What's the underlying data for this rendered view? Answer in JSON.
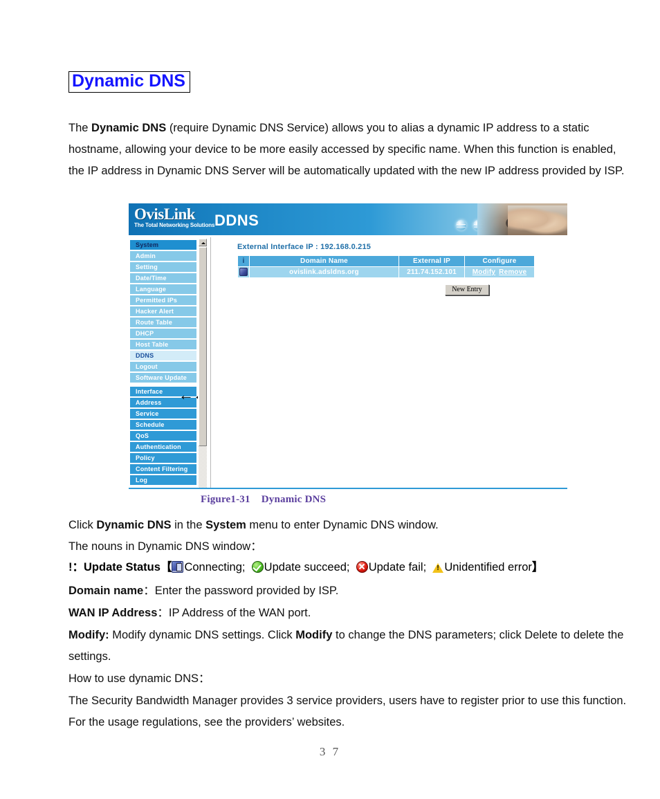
{
  "document": {
    "heading": "Dynamic DNS",
    "intro": {
      "part1": "The ",
      "bold1": "Dynamic DNS",
      "part2": " (require Dynamic DNS Service) allows you to alias a dynamic IP address to a static hostname, allowing your device to be more easily accessed by specific name. When this function is enabled, the IP address in Dynamic DNS Server will be automatically updated with the new IP address provided by ISP."
    },
    "figure_caption": {
      "label": "Figure1-31",
      "title": "Dynamic DNS"
    },
    "click_line": {
      "part1": "Click ",
      "bold1": "Dynamic DNS",
      "part2": " in the ",
      "bold2": "System",
      "part3": " menu to enter Dynamic DNS window."
    },
    "nouns_line": "The nouns in Dynamic DNS window：",
    "status_line": {
      "prefix": "!：",
      "label": "Update Status",
      "open_bracket": "【",
      "connecting": "Connecting;",
      "succeed": "Update succeed;",
      "fail": "Update fail;",
      "unidentified": "Unidentified error",
      "close_bracket": "】"
    },
    "domain_line": {
      "label": "Domain name",
      "text": "：Enter the password provided by ISP."
    },
    "wan_line": {
      "label": "WAN IP Address",
      "text": "：IP Address of the WAN port."
    },
    "modify_line": {
      "label": "Modify:",
      "part1": " Modify dynamic DNS settings. Click ",
      "bold1": "Modify",
      "part2": " to change the DNS parameters; click Delete to delete the settings."
    },
    "howto_line": "How to use dynamic DNS：",
    "providers_line": "The Security Bandwidth Manager provides 3 service providers, users have to register prior to use this function.　 For the usage regulations, see the providers’ websites.",
    "page_number": "3 7"
  },
  "screenshot": {
    "header": {
      "logo_main": "OvisLink",
      "logo_sub": "The Total Networking Solutions",
      "title": "DDNS"
    },
    "sidebar": {
      "group_system": {
        "header": "System",
        "items": [
          {
            "label": "Admin",
            "active": false
          },
          {
            "label": "Setting",
            "active": false
          },
          {
            "label": "Date/Time",
            "active": false
          },
          {
            "label": "Language",
            "active": false
          },
          {
            "label": "Permitted IPs",
            "active": false
          },
          {
            "label": "Hacker Alert",
            "active": false
          },
          {
            "label": "Route Table",
            "active": false
          },
          {
            "label": "DHCP",
            "active": false
          },
          {
            "label": "Host Table",
            "active": false
          },
          {
            "label": "DDNS",
            "active": true
          },
          {
            "label": "Logout",
            "active": false
          },
          {
            "label": "Software Update",
            "active": false
          }
        ]
      },
      "main_items": [
        {
          "label": "Interface"
        },
        {
          "label": "Address"
        },
        {
          "label": "Service"
        },
        {
          "label": "Schedule"
        },
        {
          "label": "QoS"
        },
        {
          "label": "Authentication"
        },
        {
          "label": "Policy"
        },
        {
          "label": "Content Filtering"
        },
        {
          "label": "Log"
        }
      ],
      "pointer_arrows": "←←"
    },
    "content": {
      "external_interface_ip": "External Interface IP : 192.168.0.215",
      "table": {
        "columns": [
          "i",
          "Domain Name",
          "External IP",
          "Configure"
        ],
        "rows": [
          {
            "status_icon": "connecting-status-icon",
            "domain_name": "ovislink.adsldns.org",
            "external_ip": "211.74.152.101",
            "modify_label": "Modify",
            "remove_label": "Remove"
          }
        ]
      },
      "new_entry_button": "New Entry"
    }
  },
  "colors": {
    "heading_blue": "#1414ff",
    "caption_purple": "#5b3f9e",
    "header_blue": "#2e9ad6",
    "menu_main": "#2f9ad6",
    "menu_sub": "#86c9e8",
    "menu_active": "#d3ecf8",
    "table_header": "#4ca8da",
    "table_row": "#9ed5ee"
  }
}
